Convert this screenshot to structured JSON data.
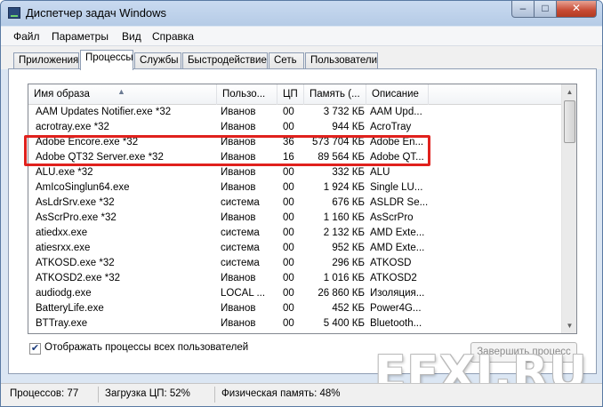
{
  "window": {
    "title": "Диспетчер задач Windows",
    "controls": {
      "minimize": "–",
      "maximize": "□",
      "close": "✕"
    }
  },
  "menu": [
    "Файл",
    "Параметры",
    "Вид",
    "Справка"
  ],
  "tabs": [
    {
      "label": "Приложения",
      "active": false
    },
    {
      "label": "Процессы",
      "active": true
    },
    {
      "label": "Службы",
      "active": false
    },
    {
      "label": "Быстродействие",
      "active": false
    },
    {
      "label": "Сеть",
      "active": false
    },
    {
      "label": "Пользователи",
      "active": false
    }
  ],
  "columns": {
    "name": "Имя образа",
    "user": "Пользо...",
    "cpu": "ЦП",
    "memory": "Память (...",
    "description": "Описание"
  },
  "sort_indicator": "▲",
  "rows": [
    {
      "name": "AAM Updates Notifier.exe *32",
      "user": "Иванов",
      "cpu": "00",
      "memory": "3 732 КБ",
      "description": "AAM Upd..."
    },
    {
      "name": "acrotray.exe *32",
      "user": "Иванов",
      "cpu": "00",
      "memory": "944 КБ",
      "description": "AcroTray"
    },
    {
      "name": "Adobe Encore.exe *32",
      "user": "Иванов",
      "cpu": "36",
      "memory": "573 704 КБ",
      "description": "Adobe En..."
    },
    {
      "name": "Adobe QT32 Server.exe *32",
      "user": "Иванов",
      "cpu": "16",
      "memory": "89 564 КБ",
      "description": "Adobe QT..."
    },
    {
      "name": "ALU.exe *32",
      "user": "Иванов",
      "cpu": "00",
      "memory": "332 КБ",
      "description": "ALU"
    },
    {
      "name": "AmIcoSinglun64.exe",
      "user": "Иванов",
      "cpu": "00",
      "memory": "1 924 КБ",
      "description": "Single LU..."
    },
    {
      "name": "AsLdrSrv.exe *32",
      "user": "система",
      "cpu": "00",
      "memory": "676 КБ",
      "description": "ASLDR Se..."
    },
    {
      "name": "AsScrPro.exe *32",
      "user": "Иванов",
      "cpu": "00",
      "memory": "1 160 КБ",
      "description": "AsScrPro"
    },
    {
      "name": "atiedxx.exe",
      "user": "система",
      "cpu": "00",
      "memory": "2 132 КБ",
      "description": "AMD Exte..."
    },
    {
      "name": "atiesrxx.exe",
      "user": "система",
      "cpu": "00",
      "memory": "952 КБ",
      "description": "AMD Exte..."
    },
    {
      "name": "ATKOSD.exe *32",
      "user": "система",
      "cpu": "00",
      "memory": "296 КБ",
      "description": "ATKOSD"
    },
    {
      "name": "ATKOSD2.exe *32",
      "user": "Иванов",
      "cpu": "00",
      "memory": "1 016 КБ",
      "description": "ATKOSD2"
    },
    {
      "name": "audiodg.exe",
      "user": "LOCAL ...",
      "cpu": "00",
      "memory": "26 860 КБ",
      "description": "Изоляция..."
    },
    {
      "name": "BatteryLife.exe",
      "user": "Иванов",
      "cpu": "00",
      "memory": "452 КБ",
      "description": "Power4G..."
    },
    {
      "name": "BTTray.exe",
      "user": "Иванов",
      "cpu": "00",
      "memory": "5 400 КБ",
      "description": "Bluetooth..."
    }
  ],
  "scrollbar": {
    "up": "▲",
    "down": "▼"
  },
  "show_all_processes": {
    "label": "Отображать процессы всех пользователей",
    "checked": true,
    "mark": "✔"
  },
  "end_process_button": "Завершить процесс",
  "status": {
    "processes": "Процессов: 77",
    "cpu_load": "Загрузка ЦП: 52%",
    "physical_memory": "Физическая память: 48%"
  },
  "watermark": "EFXI.RU",
  "colors": {
    "highlight_border": "#e0211d",
    "title_bar": "#c9daf0",
    "close_button": "#c74a33"
  }
}
